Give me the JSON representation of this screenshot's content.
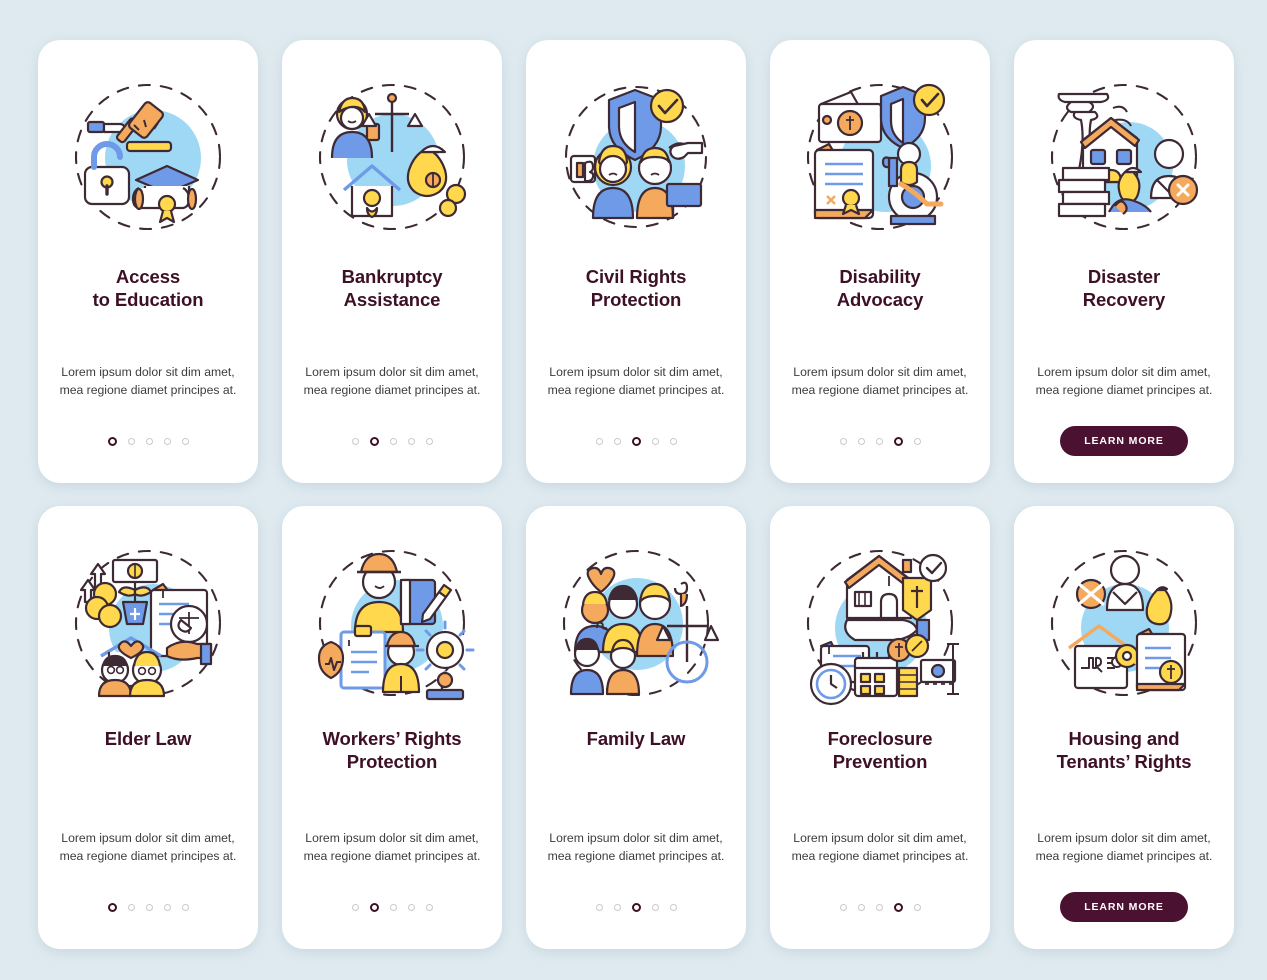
{
  "theme": {
    "page_background": "#dfeaf0",
    "card_background": "#ffffff",
    "title_color": "#3d1026",
    "body_text_color": "#3c3c3c",
    "button_background": "#4b1130",
    "button_text_color": "#ffffff",
    "dot_inactive_color": "#c9c9cf",
    "dot_active_color": "#3d1026",
    "illustration_blue": "#9fd8f5",
    "illustration_yellow": "#ffd84d",
    "illustration_orange": "#f5a95c",
    "illustration_periwinkle": "#6f9ae8",
    "illustration_outline": "#3d2a35"
  },
  "body_text": "Lorem ipsum dolor sit dim amet, mea regione diamet principes at.",
  "learn_more_label": "LEARN MORE",
  "dot_count": 5,
  "cards": [
    {
      "id": "access-to-education",
      "title": "Access\nto Education",
      "title_lines": [
        "Access",
        "to Education"
      ],
      "description": "Lorem ipsum dolor sit dim amet, mea regione diamet principes at.",
      "footer_type": "dots",
      "active_dot": 1,
      "illustration": "gavel-lock-graduation-cap-diploma"
    },
    {
      "id": "bankruptcy-assistance",
      "title": "Bankruptcy\nAssistance",
      "title_lines": [
        "Bankruptcy",
        "Assistance"
      ],
      "description": "Lorem ipsum dolor sit dim amet, mea regione diamet principes at.",
      "footer_type": "dots",
      "active_dot": 2,
      "illustration": "woman-scales-house-money-bag"
    },
    {
      "id": "civil-rights-protection",
      "title": "Civil Rights\nProtection",
      "title_lines": [
        "Civil Rights",
        "Protection"
      ],
      "description": "Lorem ipsum dolor sit dim amet, mea regione diamet principes at.",
      "footer_type": "dots",
      "active_dot": 3,
      "illustration": "shield-check-two-people-protest"
    },
    {
      "id": "disability-advocacy",
      "title": "Disability\nAdvocacy",
      "title_lines": [
        "Disability",
        "Advocacy"
      ],
      "description": "Lorem ipsum dolor sit dim amet, mea regione diamet principes at.",
      "footer_type": "dots",
      "active_dot": 4,
      "illustration": "money-shield-document-wheelchair"
    },
    {
      "id": "disaster-recovery",
      "title": "Disaster\nRecovery",
      "title_lines": [
        "Disaster",
        "Recovery"
      ],
      "description": "Lorem ipsum dolor sit dim amet, mea regione diamet principes at.",
      "footer_type": "button",
      "button_label": "LEARN MORE",
      "illustration": "tornado-broken-house-bricks-person"
    },
    {
      "id": "elder-law",
      "title": "Elder Law",
      "title_lines": [
        "Elder Law"
      ],
      "description": "Lorem ipsum dolor sit dim amet, mea regione diamet principes at.",
      "footer_type": "dots",
      "active_dot": 1,
      "illustration": "elderly-couple-coins-scales-document"
    },
    {
      "id": "workers-rights-protection",
      "title": "Workers’ Rights\nProtection",
      "title_lines": [
        "Workers’ Rights",
        "Protection"
      ],
      "description": "Lorem ipsum dolor sit dim amet, mea regione diamet principes at.",
      "footer_type": "dots",
      "active_dot": 2,
      "illustration": "construction-workers-clipboard-gear"
    },
    {
      "id": "family-law",
      "title": "Family Law",
      "title_lines": [
        "Family Law"
      ],
      "description": "Lorem ipsum dolor sit dim amet, mea regione diamet principes at.",
      "footer_type": "dots",
      "active_dot": 3,
      "illustration": "family-children-scales-lawyer"
    },
    {
      "id": "foreclosure-prevention",
      "title": "Foreclosure\nPrevention",
      "title_lines": [
        "Foreclosure",
        "Prevention"
      ],
      "description": "Lorem ipsum dolor sit dim amet, mea regione diamet principes at.",
      "footer_type": "dots",
      "active_dot": 4,
      "illustration": "house-hand-clock-calendar-money"
    },
    {
      "id": "housing-and-tenants-rights",
      "title": "Housing and\nTenants’ Rights",
      "title_lines": [
        "Housing and",
        "Tenants’ Rights"
      ],
      "description": "Lorem ipsum dolor sit dim amet, mea regione diamet principes at.",
      "footer_type": "button",
      "button_label": "LEARN MORE",
      "illustration": "rent-house-key-person-document"
    }
  ]
}
